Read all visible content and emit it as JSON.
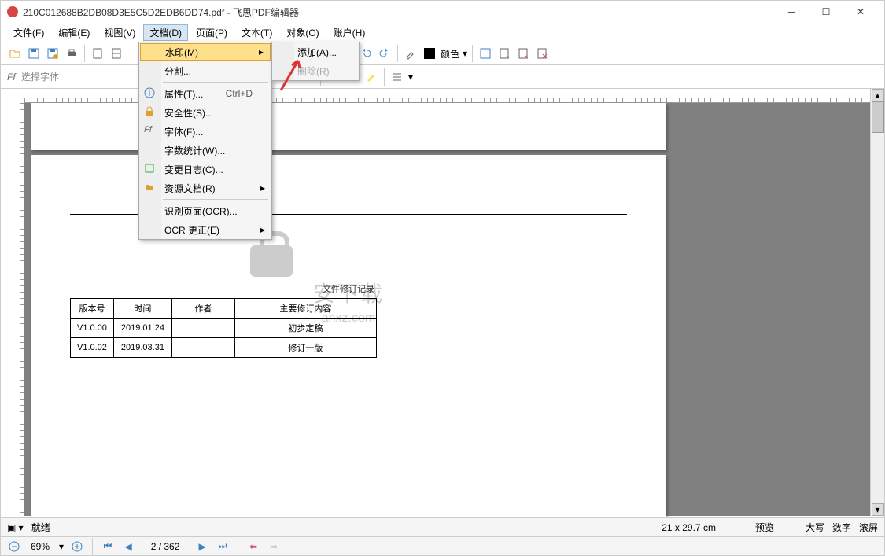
{
  "window": {
    "title": "210C012688B2DB08D3E5C5D2EDB6DD74.pdf - 飞思PDF编辑器"
  },
  "menubar": [
    "文件(F)",
    "编辑(E)",
    "视图(V)",
    "文档(D)",
    "页面(P)",
    "文本(T)",
    "对象(O)",
    "账户(H)"
  ],
  "active_menu_index": 3,
  "dropdown": {
    "items": [
      {
        "label": "水印(M)",
        "arrow": true,
        "hl": true
      },
      {
        "label": "分割...",
        "sep_after": true
      },
      {
        "label": "属性(T)...",
        "icon": "info",
        "shortcut": "Ctrl+D"
      },
      {
        "label": "安全性(S)...",
        "icon": "lock"
      },
      {
        "label": "字体(F)...",
        "icon": "font"
      },
      {
        "label": "字数统计(W)..."
      },
      {
        "label": "变更日志(C)...",
        "icon": "log"
      },
      {
        "label": "资源文档(R)",
        "arrow": true,
        "sep_after": true
      },
      {
        "label": "识别页面(OCR)..."
      },
      {
        "label": "OCR 更正(E)",
        "arrow": true
      }
    ]
  },
  "submenu": {
    "items": [
      {
        "label": "添加(A)..."
      },
      {
        "label": "删除(R)",
        "disabled": true
      }
    ]
  },
  "toolbar2": {
    "font_hint": "选择字体"
  },
  "color_label": "颜色",
  "watermark": {
    "big": "安下载",
    "sub": "anxz.com"
  },
  "doc": {
    "title": "文件修订记录",
    "headers": [
      "版本号",
      "时间",
      "作者",
      "主要修订内容"
    ],
    "rows": [
      [
        "V1.0.00",
        "2019.01.24",
        "",
        "初步定稿"
      ],
      [
        "V1.0.02",
        "2019.03.31",
        "",
        "修订一版"
      ]
    ]
  },
  "status": {
    "ready": "就绪",
    "dim": "21 x 29.7 cm",
    "preview": "预览",
    "caps": "大写",
    "num": "数字",
    "scroll": "滚屏"
  },
  "nav": {
    "zoom": "69%",
    "page": "2 / 362"
  }
}
